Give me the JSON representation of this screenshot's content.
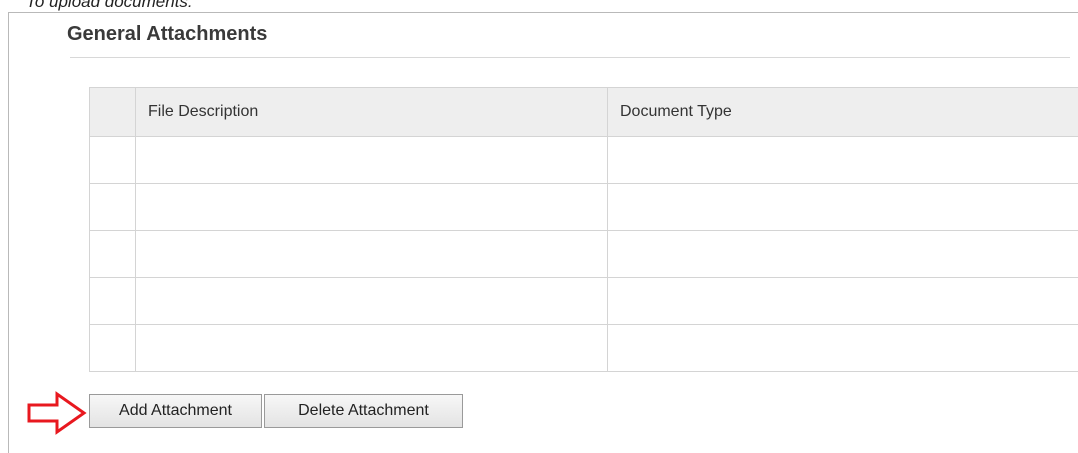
{
  "intro_text": "To upload documents:",
  "section": {
    "title": "General Attachments"
  },
  "table": {
    "columns": [
      "",
      "File Description",
      "Document Type"
    ],
    "rows": [
      [
        "",
        "",
        ""
      ],
      [
        "",
        "",
        ""
      ],
      [
        "",
        "",
        ""
      ],
      [
        "",
        "",
        ""
      ],
      [
        "",
        "",
        ""
      ]
    ]
  },
  "buttons": {
    "add_label": "Add Attachment",
    "delete_label": "Delete Attachment"
  },
  "annotation": {
    "icon": "red-outline-arrow-right-icon",
    "color": "#e8181f"
  }
}
